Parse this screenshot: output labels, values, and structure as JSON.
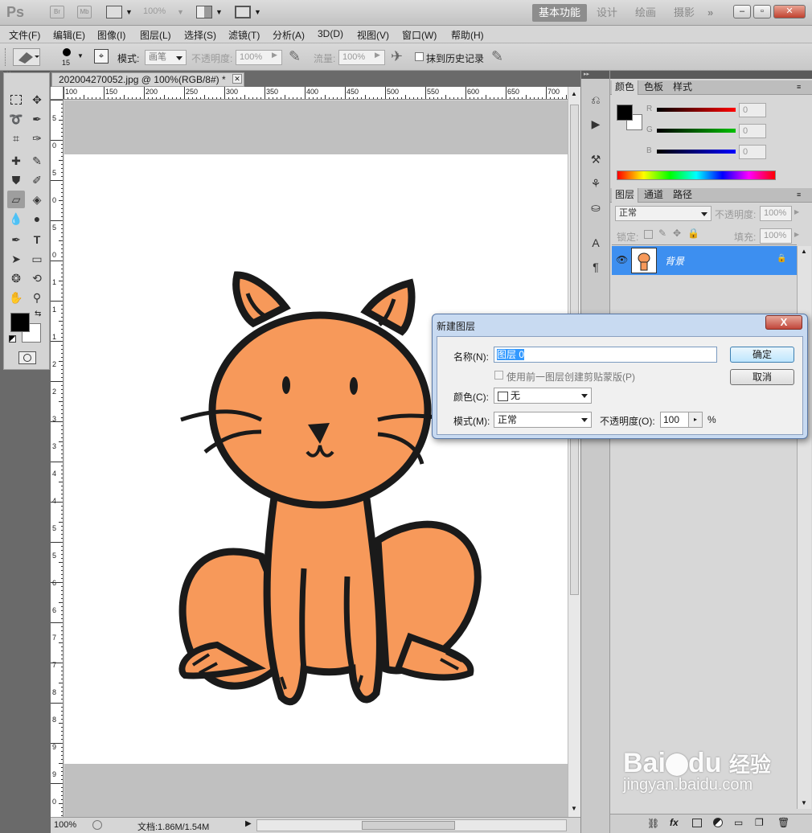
{
  "app": {
    "logo": "Ps",
    "bridge_label": "Br",
    "minibridge_label": "Mb",
    "zoom_display": "100%",
    "workspaces": [
      "基本功能",
      "设计",
      "绘画",
      "摄影"
    ],
    "more_label": "»",
    "window_buttons": [
      "–",
      "▫",
      "✕"
    ]
  },
  "menu": [
    "文件(F)",
    "编辑(E)",
    "图像(I)",
    "图层(L)",
    "选择(S)",
    "滤镜(T)",
    "分析(A)",
    "3D(D)",
    "视图(V)",
    "窗口(W)",
    "帮助(H)"
  ],
  "options": {
    "brush_size": "15",
    "mode_label": "模式:",
    "mode_value": "画笔",
    "opacity_label": "不透明度:",
    "opacity_value": "100%",
    "flow_label": "流量:",
    "flow_value": "100%",
    "erase_history_label": "抹到历史记录"
  },
  "document": {
    "tab_title": "202004270052.jpg @ 100%(RGB/8#) *",
    "close_glyph": "✕",
    "ruler_top": [
      "100",
      "150",
      "200",
      "250",
      "300",
      "350",
      "400",
      "450",
      "500",
      "550",
      "600",
      "650",
      "700"
    ],
    "ruler_left": [
      "5",
      "0",
      "5",
      "0",
      "5",
      "0",
      "1",
      "1",
      "1",
      "2",
      "2",
      "3",
      "3",
      "4",
      "4",
      "5",
      "5",
      "6",
      "6",
      "7",
      "7",
      "8",
      "8",
      "9",
      "9",
      "0"
    ],
    "status_zoom": "100%",
    "status_doc": "文档:1.86M/1.54M"
  },
  "color_panel": {
    "tabs": [
      "颜色",
      "色板",
      "样式"
    ],
    "channels": [
      {
        "label": "R",
        "value": "0",
        "color": "#ff0000"
      },
      {
        "label": "G",
        "value": "0",
        "color": "#00c000"
      },
      {
        "label": "B",
        "value": "0",
        "color": "#0000ff"
      }
    ]
  },
  "layers_panel": {
    "tabs": [
      "图层",
      "通道",
      "路径"
    ],
    "blend_mode": "正常",
    "opacity_label": "不透明度:",
    "opacity_value": "100%",
    "lock_label": "锁定:",
    "fill_label": "填充:",
    "fill_value": "100%",
    "layer_name": "背景",
    "bottom_icons": [
      "link-icon",
      "fx-icon",
      "mask-icon",
      "adjustment-icon",
      "group-icon",
      "new-layer-icon",
      "trash-icon"
    ],
    "fx_label": "fx"
  },
  "dialog": {
    "title": "新建图层",
    "close_glyph": "X",
    "name_label": "名称(N):",
    "name_value": "图层 0",
    "clip_label": "使用前一图层创建剪贴蒙版(P)",
    "color_label": "颜色(C):",
    "color_value": "无",
    "mode_label": "模式(M):",
    "mode_value": "正常",
    "opacity_label": "不透明度(O):",
    "opacity_value": "100",
    "percent": "%",
    "ok_label": "确定",
    "cancel_label": "取消"
  },
  "watermark": {
    "brand": "Bai",
    "brand2": "du",
    "brand_cn": "经验",
    "url": "jingyan.baidu.com"
  },
  "colors": {
    "cat_fill": "#f7995a",
    "cat_outline": "#1a1a1a",
    "selection_blue": "#3d8ff0"
  }
}
